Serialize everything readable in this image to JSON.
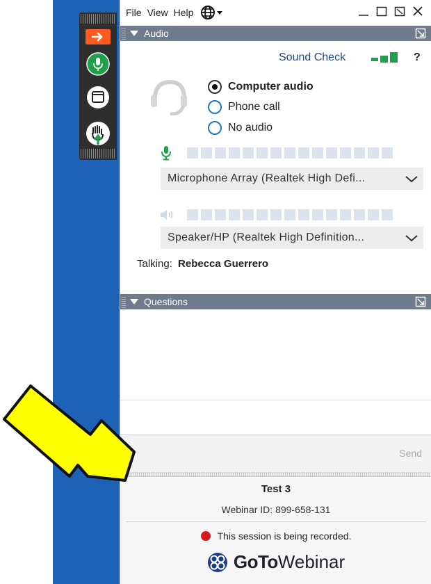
{
  "menu": {
    "file": "File",
    "view": "View",
    "help": "Help"
  },
  "icons": {
    "globe": "globe-icon",
    "minimize": "minimize-icon",
    "maximize": "maximize-icon",
    "restore": "restore-icon",
    "close": "close-icon",
    "arrow": "arrow-right-icon",
    "mic": "microphone-icon",
    "window": "window-icon",
    "hand": "raise-hand-icon",
    "headset": "headset-icon",
    "speaker": "speaker-icon",
    "chevron": "chevron-down-icon",
    "popout": "popout-icon",
    "logo": "gotowebinar-logo-icon"
  },
  "colors": {
    "desktop_blue": "#1e62b6",
    "section_header": "#6e7b8c",
    "accent_green": "#1fa04a",
    "accent_orange": "#ff5a1f",
    "radio_blue": "#1a7ac4",
    "link_blue": "#1c4a8c",
    "record_red": "#d41a1a",
    "callout_yellow": "#ffff00"
  },
  "audio": {
    "header": "Audio",
    "sound_check": "Sound Check",
    "help": "?",
    "options": [
      {
        "label": "Computer audio",
        "selected": true
      },
      {
        "label": "Phone call",
        "selected": false
      },
      {
        "label": "No audio",
        "selected": false
      }
    ],
    "microphone_device": "Microphone Array (Realtek High Defi...",
    "speaker_device": "Speaker/HP (Realtek High Definition...",
    "talking_label": "Talking:",
    "talking_name": "Rebecca Guerrero"
  },
  "questions": {
    "header": "Questions",
    "send_label": "Send"
  },
  "session": {
    "title": "Test 3",
    "webinar_id": "Webinar ID: 899-658-131",
    "recording_notice": "This session is being recorded.",
    "brand_bold": "GoTo",
    "brand_light": "Webinar"
  }
}
